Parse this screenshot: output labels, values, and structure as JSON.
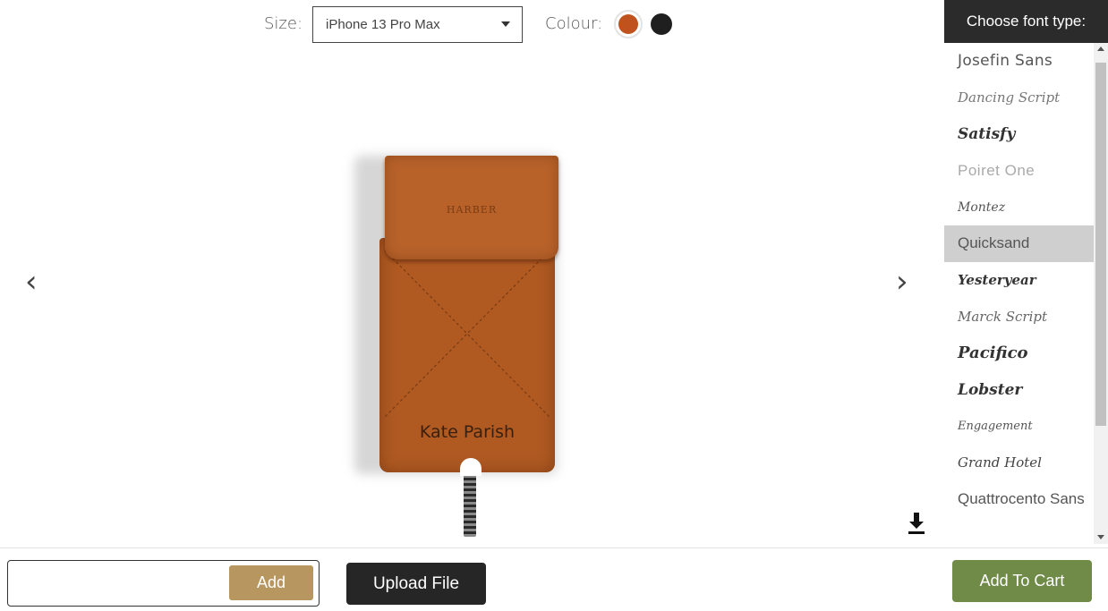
{
  "options": {
    "size_label": "Size:",
    "size_value": "iPhone 13 Pro Max",
    "colour_label": "Colour:",
    "colours": [
      {
        "name": "tan",
        "hex": "#c0531d"
      },
      {
        "name": "black",
        "hex": "#1f1f1f"
      }
    ]
  },
  "carousel": {
    "prev_glyph": "‹",
    "next_glyph": "›"
  },
  "product": {
    "logo_text": "HARBER",
    "engraving": "Kate Parish",
    "leather_color": "#b05a22"
  },
  "font_panel": {
    "title": "Choose font type:",
    "fonts": [
      "Josefin Sans",
      "Dancing Script",
      "Satisfy",
      "Poiret One",
      "Montez",
      "Quicksand",
      "Yesteryear",
      "Marck Script",
      "Pacifico",
      "Lobster",
      "Engagement",
      "Grand Hotel",
      "Quattrocento Sans"
    ],
    "selected": "Quicksand"
  },
  "bottom_bar": {
    "text_input_value": "",
    "add_label": "Add",
    "upload_label": "Upload File",
    "cart_label": "Add To Cart"
  },
  "colors": {
    "accent_gold": "#b7975f",
    "cart_green": "#708a48",
    "dark": "#262626"
  }
}
